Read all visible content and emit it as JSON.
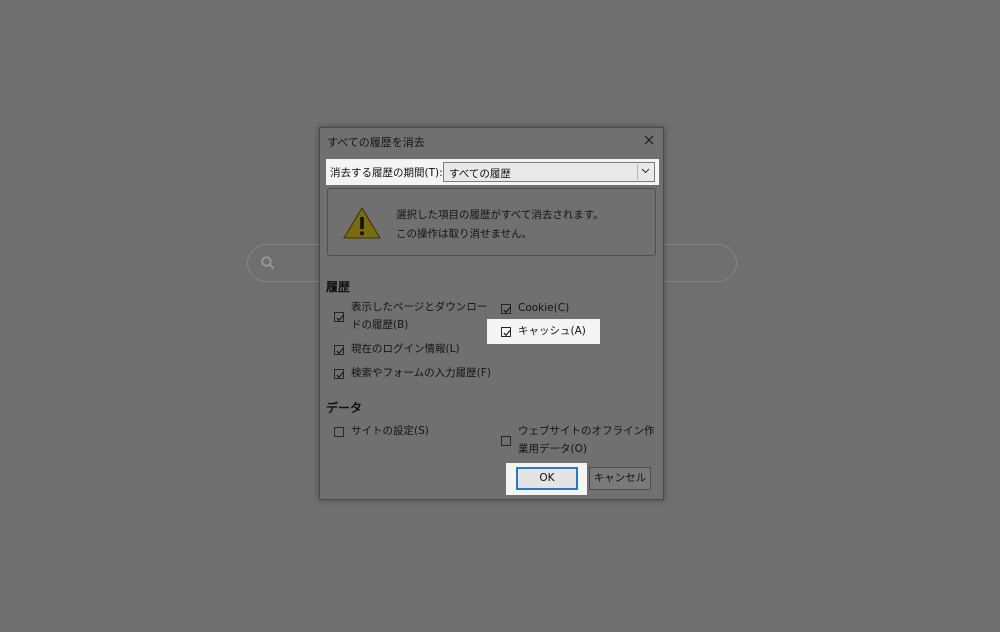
{
  "background": {
    "search_icon": "search-icon"
  },
  "dialog": {
    "title": "すべての履歴を消去",
    "close_icon": "close-icon",
    "range": {
      "label": "消去する履歴の期間(T):",
      "value": "すべての履歴"
    },
    "warning": {
      "icon": "warning-icon",
      "line1": "選択した項目の履歴がすべて消去されます。",
      "line2": "この操作は取り消せません。"
    },
    "history_section": {
      "title": "履歴",
      "items": [
        {
          "label": "表示したページとダウンロー",
          "label2": "ドの履歴(B)",
          "checked": true
        },
        {
          "label": "現在のログイン情報(L)",
          "checked": true
        },
        {
          "label": "検索やフォームの入力履歴(F)",
          "checked": true
        },
        {
          "label": "Cookie(C)",
          "checked": true
        },
        {
          "label": "キャッシュ(A)",
          "checked": true
        }
      ]
    },
    "data_section": {
      "title": "データ",
      "items": [
        {
          "label": "サイトの設定(S)",
          "checked": false
        },
        {
          "label": "ウェブサイトのオフライン作",
          "label2": "業用データ(O)",
          "checked": false
        }
      ]
    },
    "buttons": {
      "ok": "OK",
      "cancel": "キャンセル"
    },
    "colors": {
      "overlay": "#6f6f6f",
      "highlight": "#f4f4f4",
      "focus_ring": "#2f75c8"
    }
  }
}
